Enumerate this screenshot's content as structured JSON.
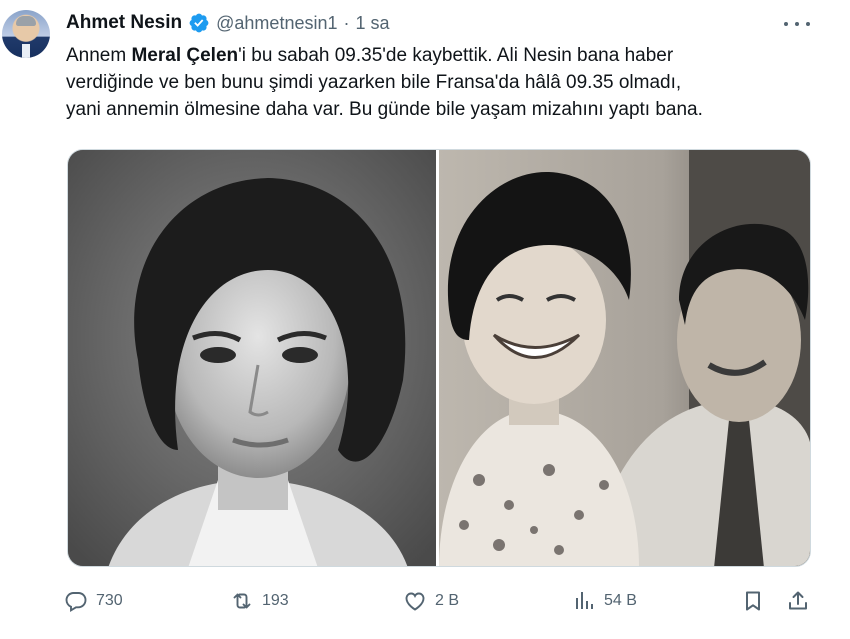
{
  "author": {
    "name": "Ahmet Nesin",
    "handle": "@ahmetnesin1",
    "separator": "·",
    "time": "1 sa",
    "verified_color": "#1d9bf0"
  },
  "tweet": {
    "line1_prefix": "Annem ",
    "line1_bold": "Meral Çelen",
    "line1_suffix": "'i bu sabah 09.35'de kaybettik. Ali Nesin bana haber",
    "line2": "verdiğinde ve ben bunu şimdi yazarken bile Fransa'da hâlâ 09.35 olmadı,",
    "line3": "yani annemin ölmesine daha var. Bu günde bile yaşam mizahını yaptı bana."
  },
  "actions": {
    "replies": "730",
    "reposts": "193",
    "likes": "2 B",
    "views": "54 B"
  },
  "icons": {
    "more": "more-options-icon",
    "reply": "reply-icon",
    "repost": "repost-icon",
    "like": "heart-icon",
    "views": "views-chart-icon",
    "bookmark": "bookmark-icon",
    "share": "share-icon"
  },
  "colors": {
    "text": "#0f1419",
    "secondary": "#536471",
    "accent": "#1d9bf0"
  }
}
